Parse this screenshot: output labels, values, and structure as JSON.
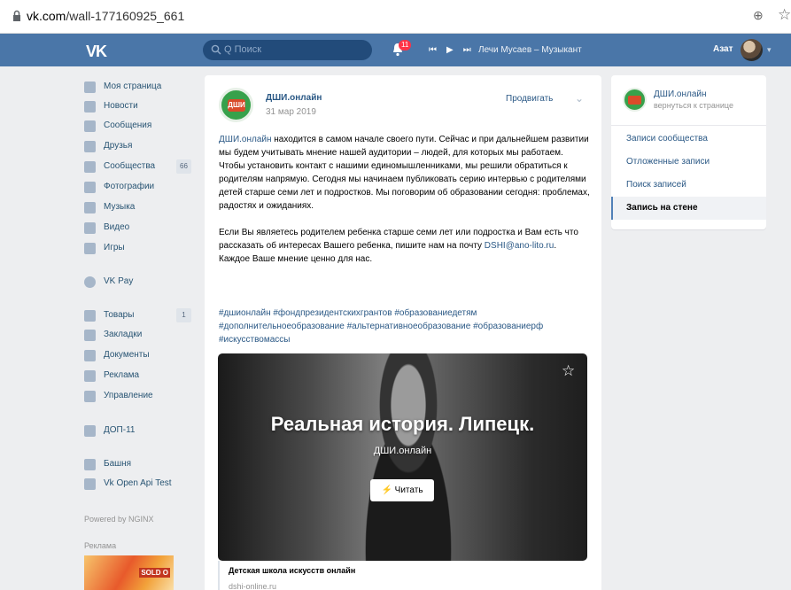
{
  "browser": {
    "url_host": "vk.com",
    "url_path": "/wall-177160925_661",
    "zoom_icon": "zoom-icon",
    "bookmark_icon": "star-icon"
  },
  "header": {
    "logo": "VK",
    "search_placeholder": "Q Поиск",
    "notifications_count": "11",
    "track": "Лечи Мусаев – Музыкант",
    "user_name": "Азат"
  },
  "sidebar": {
    "items": [
      {
        "label": "Моя страница",
        "icon": "home-icon"
      },
      {
        "label": "Новости",
        "icon": "news-icon"
      },
      {
        "label": "Сообщения",
        "icon": "messages-icon"
      },
      {
        "label": "Друзья",
        "icon": "friends-icon"
      },
      {
        "label": "Сообщества",
        "icon": "communities-icon",
        "count": "66"
      },
      {
        "label": "Фотографии",
        "icon": "photo-icon"
      },
      {
        "label": "Музыка",
        "icon": "music-icon"
      },
      {
        "label": "Видео",
        "icon": "video-icon"
      },
      {
        "label": "Игры",
        "icon": "games-icon"
      },
      {
        "label": "VK Pay",
        "icon": "vkpay-icon"
      },
      {
        "label": "Товары",
        "icon": "goods-icon",
        "count": "1"
      },
      {
        "label": "Закладки",
        "icon": "bookmarks-icon"
      },
      {
        "label": "Документы",
        "icon": "documents-icon"
      },
      {
        "label": "Реклама",
        "icon": "ads-icon"
      },
      {
        "label": "Управление",
        "icon": "manage-icon"
      },
      {
        "label": "ДОП-11",
        "icon": "group-icon"
      },
      {
        "label": "Башня",
        "icon": "app-icon"
      },
      {
        "label": "Vk Open Api Test",
        "icon": "app-icon"
      }
    ],
    "powered_by": "Powered by NGINX",
    "ads_label": "Реклама",
    "ad_text": "SOLD O"
  },
  "post": {
    "author": "ДШИ.онлайн",
    "logo_text": "ДШИ",
    "date": "31 мар 2019",
    "promote_label": "Продвигать",
    "text_link": "ДШИ.онлайн",
    "text_p1": " находится в самом начале своего пути. Сейчас и при дальнейшем развитии мы будем учитывать мнение нашей аудитории – людей, для которых мы работаем.",
    "text_p2": "Чтобы установить контакт с нашими единомышленниками, мы решили обратиться к родителям напрямую. Сегодня мы начинаем публиковать серию интервью с родителями детей старше семи лет и подростков. Мы поговорим об образовании сегодня: проблемах, радостях и ожиданиях.",
    "text_p3_a": "Если Вы являетесь родителем ребенка старше семи лет или подростка и Вам есть что рассказать об интересах Вашего ребенка, пишите нам на почту ",
    "email": "DSHI@ano-lito.ru",
    "text_p3_b": ".",
    "text_p4": "Каждое Ваше мнение ценно для нас.",
    "hashtags_line1": "#дшионлайн #фондпрезидентскихгрантов #образованиедетям",
    "hashtags_line2": "#дополнительноеобразование #альтернативноеобразование #образованиерф",
    "hashtags_line3": "#искусствомассы",
    "card": {
      "title": "Реальная история. Липецк.",
      "subtitle": "ДШИ.онлайн",
      "read_button": "⚡ Читать"
    },
    "link_title": "Детская школа искусств онлайн",
    "link_domain": "dshi-online.ru"
  },
  "right_panel": {
    "name": "ДШИ.онлайн",
    "back": "вернуться к странице",
    "items": [
      {
        "label": "Записи сообщества"
      },
      {
        "label": "Отложенные записи"
      },
      {
        "label": "Поиск записей"
      },
      {
        "label": "Запись на стене",
        "active": true
      }
    ]
  },
  "colors": {
    "header": "#4a76a8",
    "link": "#2a5885",
    "background": "#edeef0",
    "badge": "#ff3347"
  }
}
